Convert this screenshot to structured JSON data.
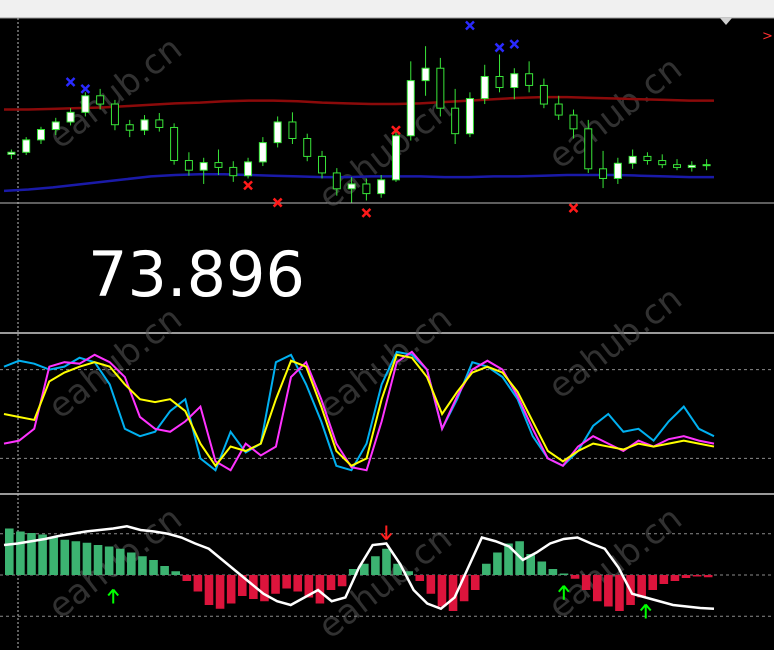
{
  "price_display": "73.896",
  "watermark": "eahub.cn",
  "chart_data": [
    {
      "type": "candlestick",
      "panel": "main",
      "ylim": [
        71.5,
        76.0
      ],
      "grid": false,
      "series": [
        {
          "name": "",
          "kind": "line",
          "color": "#8b0a0a",
          "values": [
            74.7,
            74.7,
            74.71,
            74.72,
            74.73,
            74.75,
            74.77,
            74.79,
            74.8,
            74.82,
            74.83,
            74.83,
            74.82,
            74.8,
            74.79,
            74.78,
            74.78,
            74.79,
            74.81,
            74.83,
            74.85,
            74.87,
            74.88,
            74.88,
            74.87,
            74.86,
            74.85,
            74.84,
            74.83,
            74.83
          ]
        },
        {
          "name": "",
          "kind": "line",
          "color": "#1a1aa8",
          "values": [
            73.52,
            73.54,
            73.57,
            73.61,
            73.65,
            73.69,
            73.73,
            73.75,
            73.76,
            73.76,
            73.75,
            73.74,
            73.73,
            73.72,
            73.72,
            73.73,
            73.73,
            73.73,
            73.72,
            73.72,
            73.73,
            73.73,
            73.74,
            73.75,
            73.75,
            73.75,
            73.74,
            73.73,
            73.72,
            73.72
          ]
        }
      ],
      "candles": [
        [
          74.05,
          74.12,
          73.98,
          74.08
        ],
        [
          74.08,
          74.3,
          74.04,
          74.26
        ],
        [
          74.26,
          74.45,
          74.2,
          74.41
        ],
        [
          74.41,
          74.58,
          74.33,
          74.52
        ],
        [
          74.52,
          74.72,
          74.47,
          74.66
        ],
        [
          74.66,
          74.95,
          74.6,
          74.9
        ],
        [
          74.9,
          75.0,
          74.7,
          74.78
        ],
        [
          74.78,
          74.84,
          74.4,
          74.48
        ],
        [
          74.48,
          74.55,
          74.3,
          74.4
        ],
        [
          74.4,
          74.62,
          74.33,
          74.55
        ],
        [
          74.55,
          74.65,
          74.38,
          74.44
        ],
        [
          74.44,
          74.5,
          73.9,
          73.96
        ],
        [
          73.96,
          74.08,
          73.74,
          73.82
        ],
        [
          73.82,
          74.0,
          73.62,
          73.93
        ],
        [
          73.93,
          74.12,
          73.75,
          73.86
        ],
        [
          73.86,
          73.95,
          73.65,
          73.74
        ],
        [
          73.74,
          74.0,
          73.7,
          73.94
        ],
        [
          73.94,
          74.3,
          73.88,
          74.22
        ],
        [
          74.22,
          74.6,
          74.15,
          74.52
        ],
        [
          74.52,
          74.66,
          74.2,
          74.28
        ],
        [
          74.28,
          74.35,
          73.95,
          74.02
        ],
        [
          74.02,
          74.1,
          73.7,
          73.78
        ],
        [
          73.78,
          73.85,
          73.45,
          73.55
        ],
        [
          73.55,
          73.72,
          73.35,
          73.62
        ],
        [
          73.62,
          73.7,
          73.38,
          73.48
        ],
        [
          73.48,
          73.75,
          73.42,
          73.68
        ],
        [
          73.68,
          74.4,
          73.65,
          74.32
        ],
        [
          74.32,
          75.4,
          74.25,
          75.12
        ],
        [
          75.12,
          75.62,
          74.9,
          75.3
        ],
        [
          75.3,
          75.45,
          74.6,
          74.72
        ],
        [
          74.72,
          75.0,
          74.2,
          74.35
        ],
        [
          74.35,
          74.95,
          74.3,
          74.86
        ],
        [
          74.86,
          75.35,
          74.78,
          75.18
        ],
        [
          75.18,
          75.5,
          74.95,
          75.02
        ],
        [
          75.02,
          75.3,
          74.85,
          75.22
        ],
        [
          75.22,
          75.4,
          74.95,
          75.05
        ],
        [
          75.05,
          75.15,
          74.72,
          74.78
        ],
        [
          74.78,
          74.9,
          74.55,
          74.62
        ],
        [
          74.62,
          74.7,
          74.28,
          74.42
        ],
        [
          74.42,
          74.55,
          73.78,
          73.84
        ],
        [
          73.84,
          74.1,
          73.56,
          73.7
        ],
        [
          73.7,
          74.0,
          73.62,
          73.92
        ],
        [
          73.92,
          74.12,
          73.84,
          74.02
        ],
        [
          74.02,
          74.08,
          73.9,
          73.96
        ],
        [
          73.96,
          74.05,
          73.85,
          73.9
        ],
        [
          73.9,
          73.98,
          73.82,
          73.86
        ],
        [
          73.86,
          73.95,
          73.8,
          73.89
        ],
        [
          73.89,
          73.98,
          73.82,
          73.9
        ]
      ],
      "markers_blue_x": [
        [
          4,
          75.1
        ],
        [
          5,
          75.0
        ],
        [
          31,
          75.92
        ],
        [
          33,
          75.6
        ],
        [
          34,
          75.65
        ]
      ],
      "markers_red_x": [
        [
          16,
          73.6
        ],
        [
          18,
          73.35
        ],
        [
          24,
          73.2
        ],
        [
          26,
          74.4
        ],
        [
          38,
          73.27
        ]
      ]
    },
    {
      "type": "line",
      "panel": "oscillator",
      "ylim": [
        0,
        100
      ],
      "levels": [
        80,
        20
      ],
      "series": [
        {
          "name": "",
          "color": "#00b0f0",
          "values": [
            82,
            86,
            84,
            80,
            82,
            88,
            85,
            70,
            40,
            35,
            38,
            52,
            60,
            20,
            12,
            38,
            24,
            30,
            85,
            90,
            70,
            45,
            15,
            12,
            30,
            70,
            92,
            90,
            80,
            40,
            60,
            85,
            82,
            75,
            60,
            35,
            20,
            15,
            25,
            42,
            50,
            38,
            40,
            32,
            45,
            55,
            40,
            35
          ]
        },
        {
          "name": "",
          "color": "#ff33ff",
          "values": [
            30,
            32,
            40,
            82,
            85,
            84,
            90,
            85,
            75,
            48,
            40,
            38,
            45,
            55,
            18,
            12,
            30,
            22,
            28,
            75,
            85,
            60,
            30,
            14,
            12,
            45,
            85,
            92,
            80,
            40,
            62,
            80,
            86,
            80,
            62,
            40,
            20,
            15,
            28,
            35,
            30,
            25,
            32,
            28,
            33,
            35,
            32,
            30
          ]
        },
        {
          "name": "",
          "color": "#ffff00",
          "values": [
            50,
            48,
            46,
            72,
            78,
            82,
            85,
            82,
            70,
            60,
            58,
            60,
            52,
            30,
            15,
            28,
            25,
            30,
            60,
            86,
            82,
            55,
            25,
            15,
            20,
            60,
            90,
            88,
            75,
            50,
            65,
            78,
            82,
            78,
            65,
            45,
            25,
            18,
            25,
            30,
            28,
            26,
            30,
            28,
            30,
            32,
            30,
            28
          ]
        }
      ]
    },
    {
      "type": "bar",
      "panel": "histogram",
      "ylim": [
        -100,
        100
      ],
      "levels": [
        55,
        0,
        -55
      ],
      "bars": [
        62,
        58,
        56,
        54,
        50,
        47,
        45,
        43,
        40,
        38,
        35,
        30,
        25,
        20,
        12,
        5,
        -8,
        -22,
        -40,
        -45,
        -38,
        -28,
        -32,
        -35,
        -25,
        -18,
        -22,
        -30,
        -38,
        -20,
        -15,
        8,
        15,
        25,
        35,
        15,
        5,
        -8,
        -25,
        -42,
        -48,
        -35,
        -20,
        15,
        30,
        42,
        45,
        28,
        18,
        8,
        2,
        -5,
        -20,
        -35,
        -42,
        -48,
        -40,
        -30,
        -20,
        -12,
        -8,
        -4,
        -2,
        -3
      ],
      "line": {
        "color": "#ffffff",
        "values": [
          40,
          42,
          45,
          48,
          52,
          55,
          58,
          60,
          62,
          65,
          60,
          58,
          55,
          50,
          42,
          35,
          20,
          5,
          -10,
          -25,
          -35,
          -40,
          -30,
          -20,
          -35,
          -30,
          10,
          40,
          42,
          15,
          -20,
          -38,
          -45,
          -30,
          10,
          50,
          45,
          38,
          20,
          30,
          42,
          48,
          50,
          42,
          35,
          10,
          -25,
          -30,
          -35,
          -40,
          -42,
          -44,
          -45
        ]
      },
      "arrows_green_up": [
        [
          8,
          -30
        ],
        [
          41,
          -25
        ],
        [
          47,
          -50
        ]
      ],
      "arrows_red_down": [
        [
          28,
          58
        ]
      ]
    }
  ]
}
